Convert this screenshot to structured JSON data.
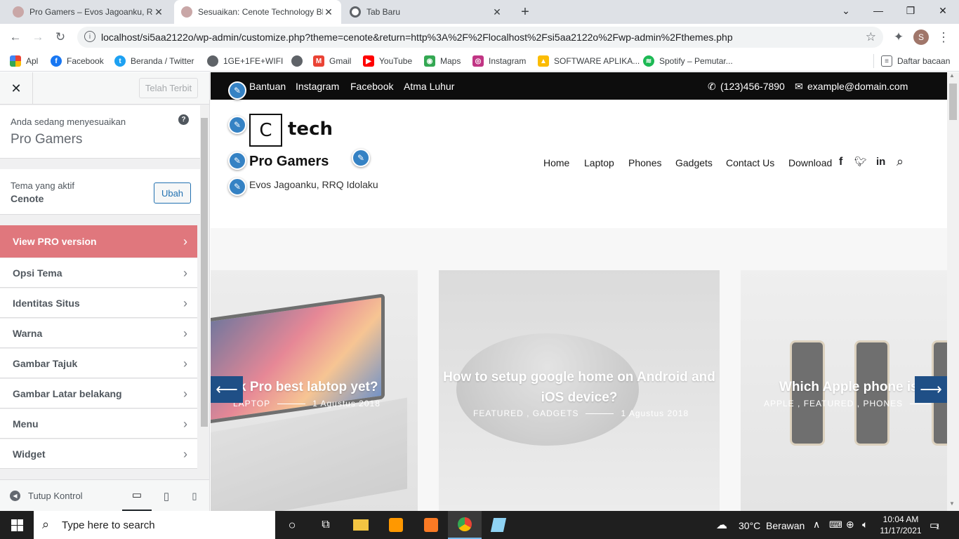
{
  "browser": {
    "tabs": [
      {
        "title": "Pro Gamers – Evos Jagoanku, RRQ",
        "active": false
      },
      {
        "title": "Sesuaikan: Cenote Technology Bl",
        "active": true
      },
      {
        "title": "Tab Baru",
        "active": false
      }
    ],
    "new_tab": "+",
    "url": "localhost/si5aa2122o/wp-admin/customize.php?theme=cenote&return=http%3A%2F%2Flocalhost%2Fsi5aa2122o%2Fwp-admin%2Fthemes.php",
    "profile_initial": "S",
    "bookmarks": [
      "Apl",
      "Facebook",
      "Beranda / Twitter",
      "1GE+1FE+WIFI",
      "Gmail",
      "YouTube",
      "Maps",
      "Instagram",
      "SOFTWARE APLIKA...",
      "Spotify – Pemutar..."
    ],
    "reading_list": "Daftar bacaan"
  },
  "customizer": {
    "publish_label": "Telah Terbit",
    "customizing_label": "Anda sedang menyesuaikan",
    "site_name": "Pro Gamers",
    "active_theme_label": "Tema yang aktif",
    "active_theme": "Cenote",
    "change_label": "Ubah",
    "pro_label": "View PRO version",
    "menu": [
      "Opsi Tema",
      "Identitas Situs",
      "Warna",
      "Gambar Tajuk",
      "Gambar Latar belakang",
      "Menu",
      "Widget"
    ],
    "hide_controls": "Tutup Kontrol"
  },
  "site": {
    "top_links": [
      "Bantuan",
      "Instagram",
      "Facebook",
      "Atma Luhur"
    ],
    "phone": "(123)456-7890",
    "email": "example@domain.com",
    "logo_letter": "C",
    "logo_text": "tech",
    "title": "Pro Gamers",
    "tagline": "Evos Jagoanku, RRQ Idolaku",
    "nav": [
      "Home",
      "Laptop",
      "Phones",
      "Gadgets",
      "Contact Us",
      "Download"
    ],
    "slides": [
      {
        "title": "k Pro best labtop yet?",
        "cats": "LAPTOP",
        "date": "1 Agustus 2018"
      },
      {
        "title": "How to setup google home on Android and iOS device?",
        "cats": "FEATURED ,  GADGETS",
        "date": "1 Agustus 2018"
      },
      {
        "title": "Which Apple phone is",
        "cats": "APPLE ,  FEATURED ,  PHONES",
        "date": ""
      }
    ],
    "prev_arrow": "⟵",
    "next_arrow": "⟶"
  },
  "taskbar": {
    "search_placeholder": "Type here to search",
    "weather": "30°C  Berawan",
    "time": "10:04 AM",
    "date": "11/17/2021",
    "notifications": "1"
  },
  "colors": {
    "accent": "#3582c4",
    "pro": "#e0777d",
    "topbar": "#0d0d0d",
    "arrow": "#1f4f86"
  }
}
